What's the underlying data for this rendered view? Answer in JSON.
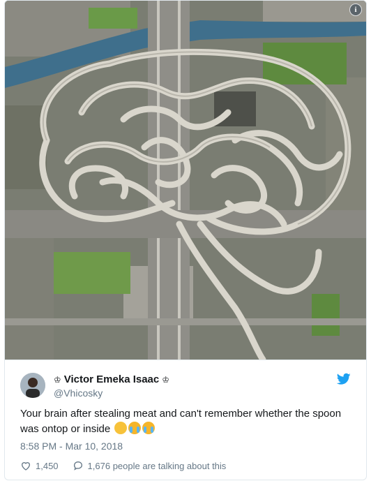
{
  "media": {
    "description_icon": "info-icon",
    "info_glyph": "i"
  },
  "tweet": {
    "author_name": "Victor Emeka Isaac",
    "crown_left": "♔",
    "crown_right": "♔",
    "handle": "@Vhicosky",
    "text": "Your brain after stealing meat and can't remember whether the spoon was ontop or inside",
    "emojis": [
      "thinking-face",
      "loudly-crying-face",
      "loudly-crying-face"
    ],
    "timestamp": "8:58 PM - Mar 10, 2018",
    "likes": "1,450",
    "talking": "1,676 people are talking about this"
  },
  "colors": {
    "twitter_blue": "#1da1f2",
    "secondary_text": "#657786",
    "border": "#e1e8ed"
  }
}
